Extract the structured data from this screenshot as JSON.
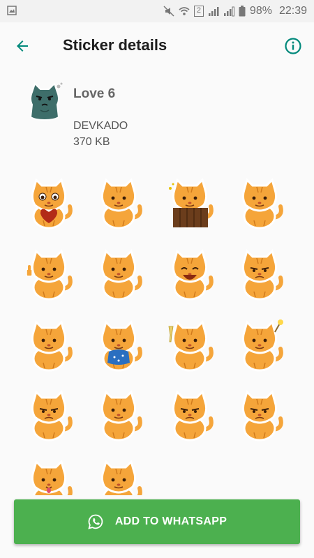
{
  "status_bar": {
    "battery": "98%",
    "time": "22:39",
    "sim_badge": "2"
  },
  "app_bar": {
    "title": "Sticker details",
    "back_icon": "arrow-back-icon",
    "info_icon": "info-icon"
  },
  "pack": {
    "name": "Love 6",
    "publisher": "DEVKADO",
    "size": "370 KB"
  },
  "stickers": [
    {
      "pose": "heart"
    },
    {
      "pose": "think"
    },
    {
      "pose": "fence"
    },
    {
      "pose": "sit"
    },
    {
      "pose": "thumb"
    },
    {
      "pose": "smirk"
    },
    {
      "pose": "laugh"
    },
    {
      "pose": "grumpy"
    },
    {
      "pose": "lie"
    },
    {
      "pose": "dance"
    },
    {
      "pose": "champagne"
    },
    {
      "pose": "sparkler"
    },
    {
      "pose": "sad"
    },
    {
      "pose": "shrug"
    },
    {
      "pose": "lie-grumpy"
    },
    {
      "pose": "grr"
    },
    {
      "pose": "tongue"
    },
    {
      "pose": "peek"
    }
  ],
  "add_button": {
    "label": "ADD TO WHATSAPP",
    "icon": "whatsapp-icon"
  },
  "colors": {
    "accent": "#00897b",
    "button": "#4cb04f",
    "cat": "#f5a53a"
  }
}
